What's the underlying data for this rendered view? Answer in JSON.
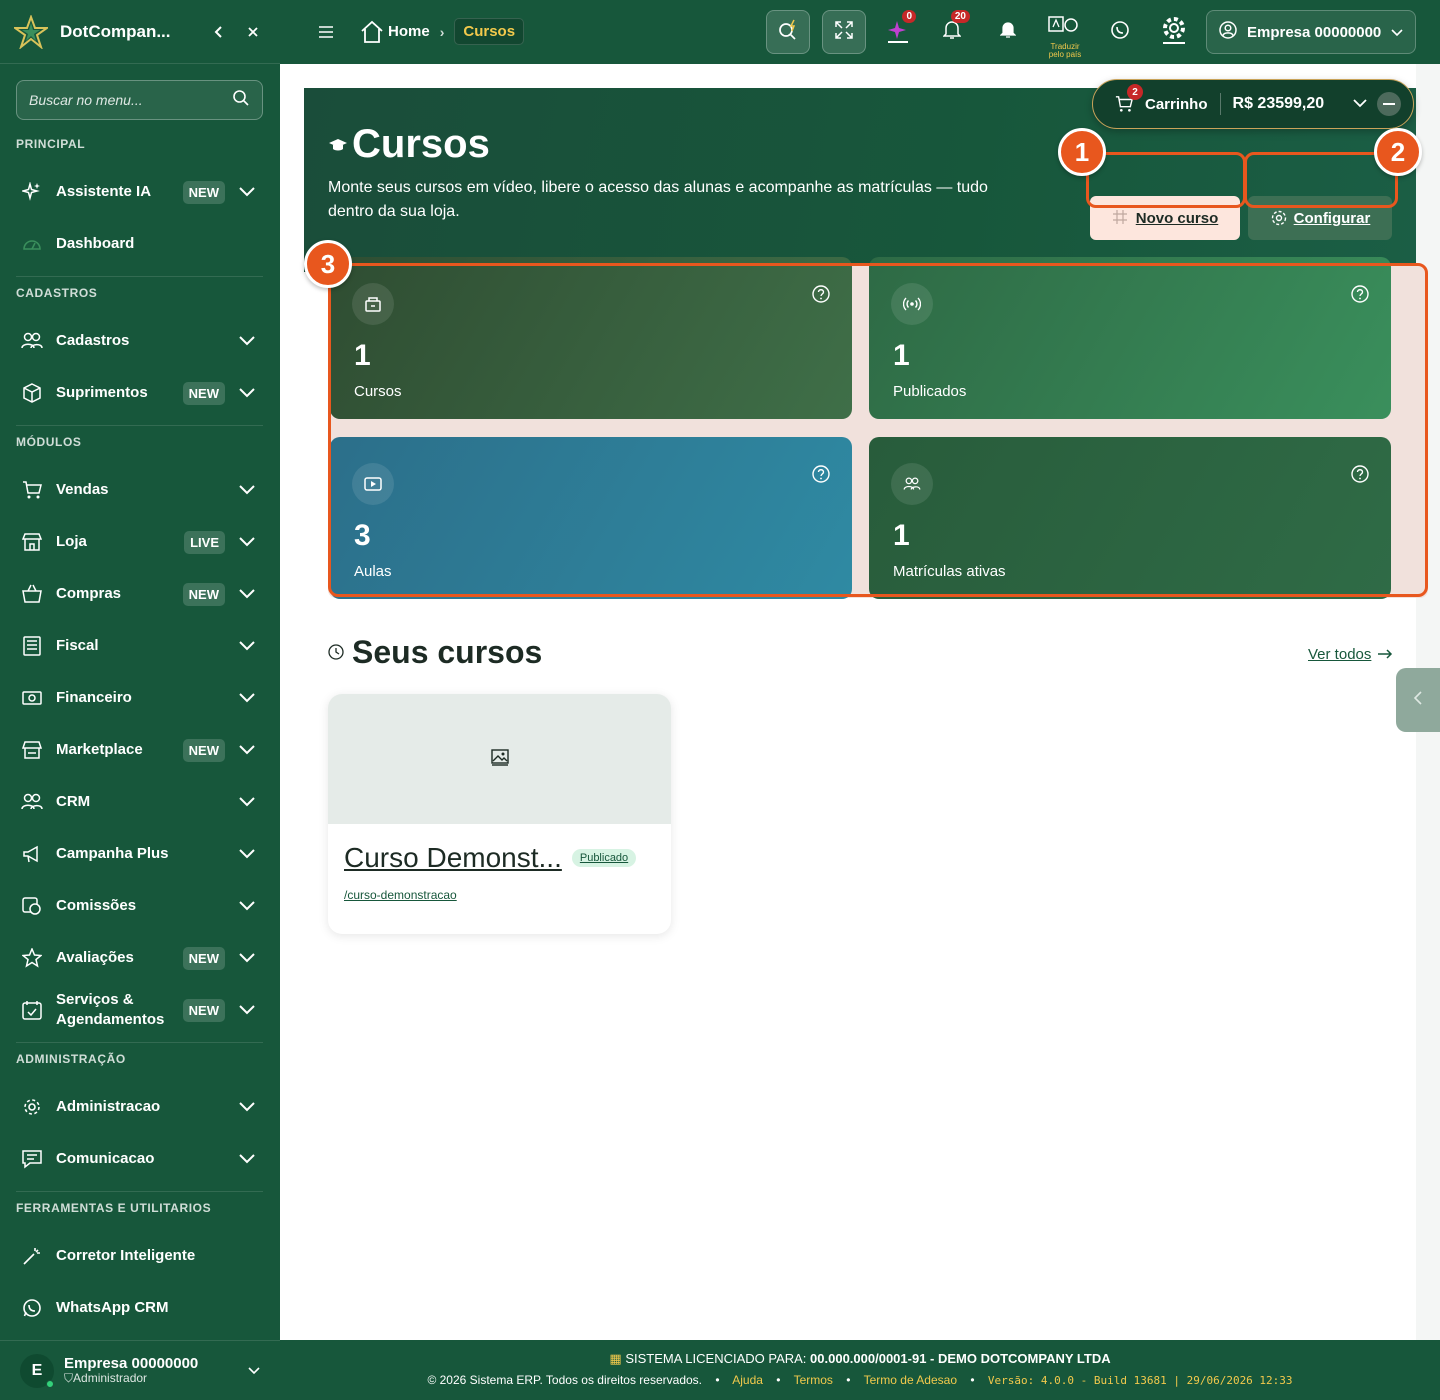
{
  "brand": {
    "name": "DotCompan..."
  },
  "sidebar": {
    "search_placeholder": "Buscar no menu...",
    "sections": {
      "principal": "PRINCIPAL",
      "cadastros": "CADASTROS",
      "modulos": "MÓDULOS",
      "administracao": "ADMINISTRAÇÃO",
      "ferramentas": "FERRAMENTAS E UTILITARIOS"
    },
    "items": {
      "assistente": {
        "label": "Assistente IA",
        "badge": "NEW"
      },
      "dashboard": {
        "label": "Dashboard"
      },
      "cadastros": {
        "label": "Cadastros"
      },
      "suprimentos": {
        "label": "Suprimentos",
        "badge": "NEW"
      },
      "vendas": {
        "label": "Vendas"
      },
      "loja": {
        "label": "Loja",
        "badge": "LIVE"
      },
      "compras": {
        "label": "Compras",
        "badge": "NEW"
      },
      "fiscal": {
        "label": "Fiscal"
      },
      "financeiro": {
        "label": "Financeiro"
      },
      "marketplace": {
        "label": "Marketplace",
        "badge": "NEW"
      },
      "crm": {
        "label": "CRM"
      },
      "campanha": {
        "label": "Campanha Plus"
      },
      "comissoes": {
        "label": "Comissões"
      },
      "avaliacoes": {
        "label": "Avaliações",
        "badge": "NEW"
      },
      "servicos": {
        "label": "Serviços & Agendamentos",
        "badge": "NEW"
      },
      "administracao": {
        "label": "Administracao"
      },
      "comunicacao": {
        "label": "Comunicacao"
      },
      "corretor": {
        "label": "Corretor Inteligente"
      },
      "whatsapp": {
        "label": "WhatsApp CRM"
      }
    },
    "user": {
      "name": "Empresa 00000000",
      "role": "Administrador",
      "initial": "E"
    }
  },
  "topbar": {
    "breadcrumb": {
      "home": "Home",
      "current": "Cursos"
    },
    "ai_count": "0",
    "notif_count": "20",
    "translate_label": "Traduzir pelo país",
    "company": "Empresa 00000000"
  },
  "cart": {
    "count": "2",
    "label": "Carrinho",
    "total": "R$ 23599,20"
  },
  "hero": {
    "title": "Cursos",
    "description": "Monte seus cursos em vídeo, libere o acesso das alunas e acompanhe as matrículas — tudo dentro da sua loja.",
    "new_button": "Novo curso",
    "config_button": "Configurar"
  },
  "markers": {
    "one": "1",
    "two": "2",
    "three": "3"
  },
  "stats": [
    {
      "value": "1",
      "label": "Cursos"
    },
    {
      "value": "1",
      "label": "Publicados"
    },
    {
      "value": "3",
      "label": "Aulas"
    },
    {
      "value": "1",
      "label": "Matrículas ativas"
    }
  ],
  "courses_section": {
    "title": "Seus cursos",
    "see_all": "Ver todos"
  },
  "courses": [
    {
      "name": "Curso Demonstração",
      "display_name": "Curso Demonst...",
      "status": "Publicado",
      "slug": "/curso-demonstracao"
    }
  ],
  "footer": {
    "licensed_label": "SISTEMA LICENCIADO PARA:",
    "licensed_to": "00.000.000/0001-91 - DEMO DOTCOMPANY LTDA",
    "copyright": "© 2026 Sistema ERP. Todos os direitos reservados.",
    "links": [
      "Ajuda",
      "Termos",
      "Termo de Adesao"
    ],
    "version": "Versão: 4.0.0 - Build 13681 | 29/06/2026 12:33"
  },
  "colors": {
    "primary": "#17573b",
    "accent": "#e8571e",
    "gold": "#f2c94c"
  }
}
